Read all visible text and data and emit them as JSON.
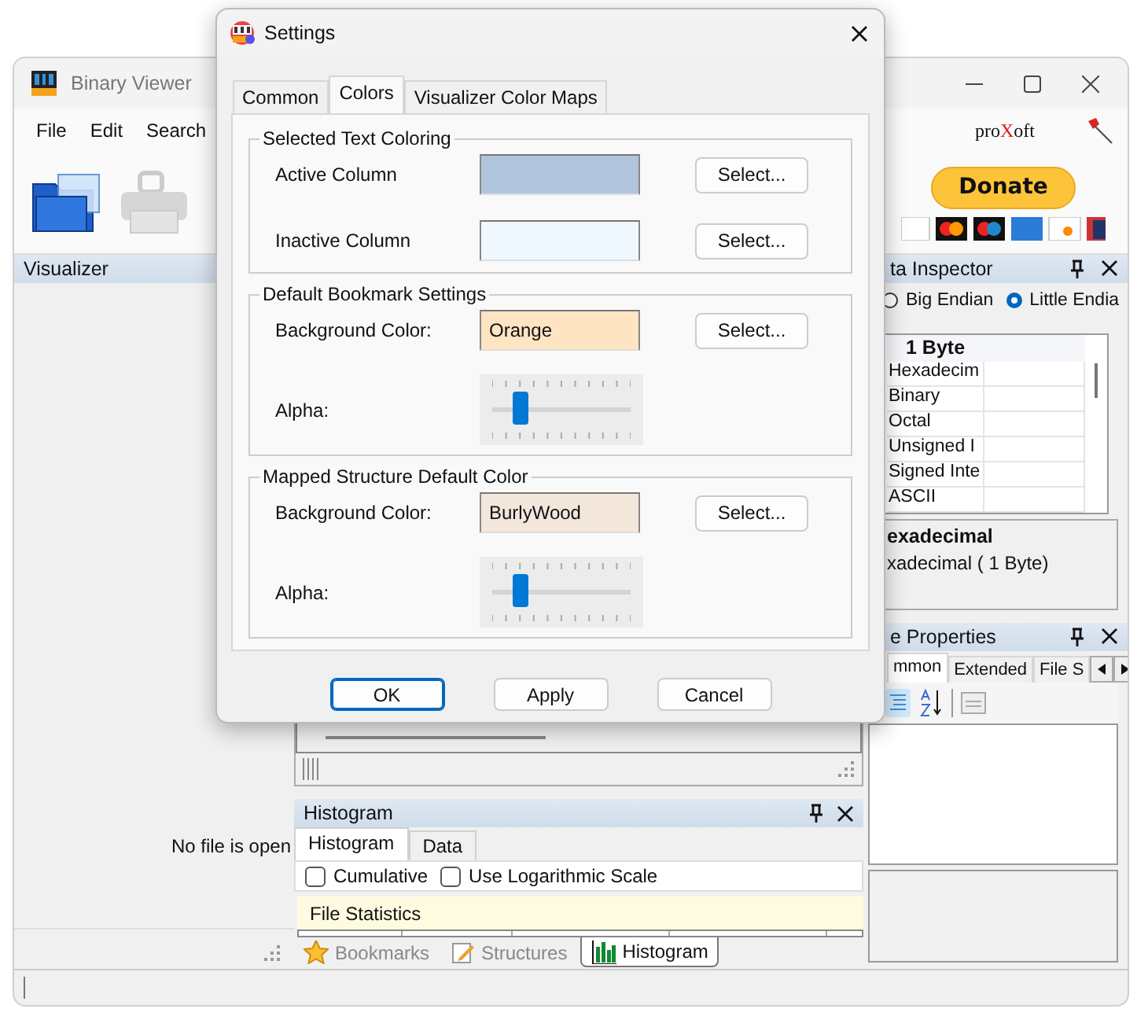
{
  "main_window": {
    "title": "Binary Viewer",
    "menu": [
      "File",
      "Edit",
      "Search"
    ],
    "logo": {
      "before": "pro",
      "mark": "X",
      "after": "oft"
    },
    "donate_button": "Donate",
    "visualizer": {
      "title": "Visualizer",
      "message": "No file is open"
    },
    "data_inspector": {
      "title": "ta Inspector",
      "endian": [
        {
          "label": "Big Endian",
          "selected": false
        },
        {
          "label": "Little Endia",
          "selected": true
        }
      ],
      "grid_header": "1 Byte",
      "rows": [
        "Hexadecim",
        "Binary",
        "Octal",
        "Unsigned I",
        "Signed Inte",
        "ASCII"
      ],
      "description_title": "exadecimal",
      "description": "xadecimal ( 1 Byte)"
    },
    "properties": {
      "title": "e Properties",
      "tabs": [
        {
          "label": "mmon",
          "selected": true
        },
        {
          "label": "Extended",
          "selected": false
        },
        {
          "label": "File S",
          "selected": false
        }
      ]
    },
    "histogram": {
      "title": "Histogram",
      "tabs": [
        {
          "label": "Histogram",
          "selected": true
        },
        {
          "label": "Data",
          "selected": false
        }
      ],
      "options": [
        {
          "label": "Cumulative",
          "checked": false
        },
        {
          "label": "Use Logarithmic Scale",
          "checked": false
        }
      ],
      "statistics_title": "File Statistics"
    },
    "bottom_tabs": [
      {
        "label": "Bookmarks",
        "kind": "bookmarks",
        "selected": false
      },
      {
        "label": "Structures",
        "kind": "structures",
        "selected": false
      },
      {
        "label": "Histogram",
        "kind": "histogram",
        "selected": true
      }
    ]
  },
  "dialog": {
    "title": "Settings",
    "tabs": [
      {
        "label": "Common",
        "selected": false
      },
      {
        "label": "Colors",
        "selected": true
      },
      {
        "label": "Visualizer Color Maps",
        "selected": false
      }
    ],
    "groups": [
      {
        "title": "Selected Text Coloring",
        "rows": [
          {
            "kind": "color",
            "label": "Active Column",
            "color": "#b0c4de",
            "button": "Select..."
          },
          {
            "kind": "color",
            "label": "Inactive Column",
            "color": "#f0f8ff",
            "button": "Select..."
          }
        ]
      },
      {
        "title": "Default Bookmark Settings",
        "rows": [
          {
            "kind": "color",
            "label": "Background Color:",
            "color": "#fde4c2",
            "value": "Orange",
            "button": "Select..."
          },
          {
            "kind": "slider",
            "label": "Alpha:",
            "level": 0.2
          }
        ]
      },
      {
        "title": "Mapped Structure Default Color",
        "rows": [
          {
            "kind": "color",
            "label": "Background Color:",
            "color": "#f3e7dc",
            "value": "BurlyWood",
            "button": "Select..."
          },
          {
            "kind": "slider",
            "label": "Alpha:",
            "level": 0.2
          }
        ]
      }
    ],
    "buttons": [
      {
        "label": "OK",
        "default": true
      },
      {
        "label": "Apply",
        "default": false
      },
      {
        "label": "Cancel",
        "default": false
      }
    ]
  }
}
